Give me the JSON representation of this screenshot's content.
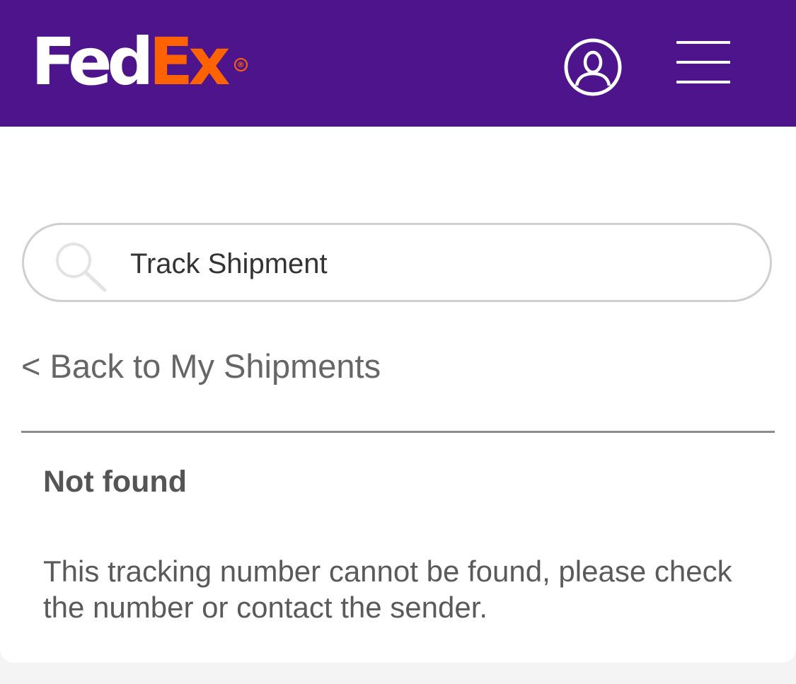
{
  "header": {
    "logo": {
      "part1": "Fed",
      "part2": "Ex",
      "registered_mark": "®"
    },
    "background_color": "#4d148c",
    "account_icon": "user-account-icon",
    "menu_icon": "hamburger-menu-icon"
  },
  "search": {
    "icon": "search-icon",
    "placeholder": "Track Shipment",
    "value": ""
  },
  "navigation": {
    "back_link_label": "< Back to My Shipments"
  },
  "result": {
    "title": "Not found",
    "message": "This tracking number cannot be found, please check the number or contact the sender."
  },
  "colors": {
    "brand_purple": "#4d148c",
    "brand_orange": "#ff6200"
  }
}
